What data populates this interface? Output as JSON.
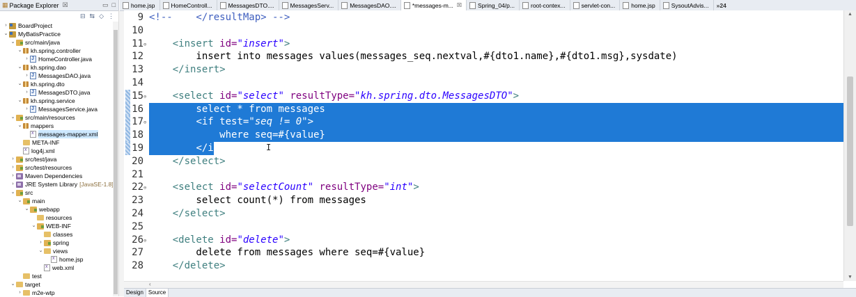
{
  "explorer": {
    "title": "Package Explorer",
    "close": "☒",
    "items": [
      {
        "label": "BoardProject",
        "indent": 0,
        "arrow": ">",
        "icon": "project"
      },
      {
        "label": "MyBatisPractice",
        "indent": 0,
        "arrow": "v",
        "icon": "project"
      },
      {
        "label": "src/main/java",
        "indent": 1,
        "arrow": "v",
        "icon": "srcfolder"
      },
      {
        "label": "kh.spring.controller",
        "indent": 2,
        "arrow": "v",
        "icon": "pkg"
      },
      {
        "label": "HomeController.java",
        "indent": 3,
        "arrow": ">",
        "icon": "jfile"
      },
      {
        "label": "kh.spring.dao",
        "indent": 2,
        "arrow": "v",
        "icon": "pkg"
      },
      {
        "label": "MessagesDAO.java",
        "indent": 3,
        "arrow": ">",
        "icon": "jfile"
      },
      {
        "label": "kh.spring.dto",
        "indent": 2,
        "arrow": "v",
        "icon": "pkg"
      },
      {
        "label": "MessagesDTO.java",
        "indent": 3,
        "arrow": ">",
        "icon": "jfile"
      },
      {
        "label": "kh.spring.service",
        "indent": 2,
        "arrow": "v",
        "icon": "pkg"
      },
      {
        "label": "MessagesService.java",
        "indent": 3,
        "arrow": ">",
        "icon": "jfile"
      },
      {
        "label": "src/main/resources",
        "indent": 1,
        "arrow": "v",
        "icon": "srcfolder"
      },
      {
        "label": "mappers",
        "indent": 2,
        "arrow": "v",
        "icon": "pkg"
      },
      {
        "label": "messages-mapper.xml",
        "indent": 3,
        "arrow": "",
        "icon": "xfile",
        "selected": true
      },
      {
        "label": "META-INF",
        "indent": 2,
        "arrow": "",
        "icon": "folder"
      },
      {
        "label": "log4j.xml",
        "indent": 2,
        "arrow": "",
        "icon": "xfile"
      },
      {
        "label": "src/test/java",
        "indent": 1,
        "arrow": ">",
        "icon": "srcfolder"
      },
      {
        "label": "src/test/resources",
        "indent": 1,
        "arrow": ">",
        "icon": "srcfolder"
      },
      {
        "label": "Maven Dependencies",
        "indent": 1,
        "arrow": ">",
        "icon": "lib"
      },
      {
        "label": "JRE System Library",
        "indent": 1,
        "arrow": ">",
        "icon": "lib",
        "deco": "[JavaSE-1.8]"
      },
      {
        "label": "src",
        "indent": 1,
        "arrow": "v",
        "icon": "srcfolder"
      },
      {
        "label": "main",
        "indent": 2,
        "arrow": "v",
        "icon": "srcfolder"
      },
      {
        "label": "webapp",
        "indent": 3,
        "arrow": "v",
        "icon": "srcfolder"
      },
      {
        "label": "resources",
        "indent": 4,
        "arrow": "",
        "icon": "folder"
      },
      {
        "label": "WEB-INF",
        "indent": 4,
        "arrow": "v",
        "icon": "srcfolder"
      },
      {
        "label": "classes",
        "indent": 5,
        "arrow": "",
        "icon": "folder"
      },
      {
        "label": "spring",
        "indent": 5,
        "arrow": ">",
        "icon": "srcfolder"
      },
      {
        "label": "views",
        "indent": 5,
        "arrow": "v",
        "icon": "folder"
      },
      {
        "label": "home.jsp",
        "indent": 6,
        "arrow": "",
        "icon": "xfile"
      },
      {
        "label": "web.xml",
        "indent": 5,
        "arrow": "",
        "icon": "xfile"
      },
      {
        "label": "test",
        "indent": 2,
        "arrow": "",
        "icon": "folder"
      },
      {
        "label": "target",
        "indent": 1,
        "arrow": "v",
        "icon": "folder"
      },
      {
        "label": "m2e-wtp",
        "indent": 2,
        "arrow": ">",
        "icon": "folder"
      }
    ]
  },
  "tabs": [
    {
      "label": "home.jsp"
    },
    {
      "label": "HomeControll..."
    },
    {
      "label": "MessagesDTO...."
    },
    {
      "label": "MessagesServ..."
    },
    {
      "label": "MessagesDAO...."
    },
    {
      "label": "*messages-m...",
      "active": true
    },
    {
      "label": "Spring_04/p..."
    },
    {
      "label": "root-contex..."
    },
    {
      "label": "servlet-con..."
    },
    {
      "label": "home.jsp"
    },
    {
      "label": "SysoutAdvis..."
    },
    {
      "label": "»24",
      "overflow": true
    }
  ],
  "editor": {
    "lines": [
      {
        "n": "9",
        "parts": [
          [
            "cmt",
            "<!--    </resultMap> -->"
          ]
        ]
      },
      {
        "n": "10",
        "parts": []
      },
      {
        "n": "11",
        "fold": true,
        "parts": [
          [
            "txt",
            "    "
          ],
          [
            "tag",
            "<insert "
          ],
          [
            "attr",
            "id="
          ],
          [
            "val",
            "\"insert\""
          ],
          [
            "tag",
            ">"
          ]
        ]
      },
      {
        "n": "12",
        "parts": [
          [
            "txt",
            "        insert into messages values(messages_seq.nextval,#{dto1.name},#{dto1.msg},sysdate)"
          ]
        ]
      },
      {
        "n": "13",
        "parts": [
          [
            "txt",
            "    "
          ],
          [
            "tag",
            "</insert>"
          ]
        ]
      },
      {
        "n": "14",
        "parts": []
      },
      {
        "n": "15",
        "fold": true,
        "changed": true,
        "parts": [
          [
            "txt",
            "    "
          ],
          [
            "tag",
            "<select "
          ],
          [
            "attr",
            "id="
          ],
          [
            "val",
            "\"select\""
          ],
          [
            "txt",
            " "
          ],
          [
            "attr",
            "resultType="
          ],
          [
            "val",
            "\"kh.spring.dto.MessagesDTO\""
          ],
          [
            "tag",
            ">"
          ]
        ]
      },
      {
        "n": "16",
        "sel": "full",
        "changed": true,
        "parts": [
          [
            "txt",
            "        select * from messages"
          ]
        ]
      },
      {
        "n": "17",
        "sel": "full",
        "changed": true,
        "fold": true,
        "parts": [
          [
            "txt",
            "        "
          ],
          [
            "tag",
            "<if "
          ],
          [
            "attr",
            "test="
          ],
          [
            "val",
            "\"seq != 0\""
          ],
          [
            "tag",
            ">"
          ]
        ]
      },
      {
        "n": "18",
        "sel": "full",
        "changed": true,
        "parts": [
          [
            "txt",
            "            where seq=#{value}"
          ]
        ]
      },
      {
        "n": "19",
        "sel": "partial",
        "changed": true,
        "parts": [
          [
            "txt",
            "        "
          ],
          [
            "tag",
            "</if>"
          ]
        ]
      },
      {
        "n": "20",
        "parts": [
          [
            "txt",
            "    "
          ],
          [
            "tag",
            "</select>"
          ]
        ]
      },
      {
        "n": "21",
        "parts": []
      },
      {
        "n": "22",
        "fold": true,
        "parts": [
          [
            "txt",
            "    "
          ],
          [
            "tag",
            "<select "
          ],
          [
            "attr",
            "id="
          ],
          [
            "val",
            "\"selectCount\""
          ],
          [
            "txt",
            " "
          ],
          [
            "attr",
            "resultType="
          ],
          [
            "val",
            "\"int\""
          ],
          [
            "tag",
            ">"
          ]
        ]
      },
      {
        "n": "23",
        "parts": [
          [
            "txt",
            "        select count(*) from messages"
          ]
        ]
      },
      {
        "n": "24",
        "parts": [
          [
            "txt",
            "    "
          ],
          [
            "tag",
            "</select>"
          ]
        ]
      },
      {
        "n": "25",
        "parts": []
      },
      {
        "n": "26",
        "fold": true,
        "parts": [
          [
            "txt",
            "    "
          ],
          [
            "tag",
            "<delete "
          ],
          [
            "attr",
            "id="
          ],
          [
            "val",
            "\"delete\""
          ],
          [
            "tag",
            ">"
          ]
        ]
      },
      {
        "n": "27",
        "parts": [
          [
            "txt",
            "        delete from messages where seq=#{value}"
          ]
        ]
      },
      {
        "n": "28",
        "parts": [
          [
            "txt",
            "    "
          ],
          [
            "tag",
            "</delete>"
          ]
        ]
      }
    ]
  },
  "bottom_tabs": [
    {
      "label": "Design"
    },
    {
      "label": "Source",
      "active": true
    }
  ],
  "colors": {
    "selection": "#1f7ad6",
    "tag": "#3f7f7f",
    "attr": "#7f007f",
    "value": "#2a00ff",
    "comment": "#3f5fbf"
  }
}
